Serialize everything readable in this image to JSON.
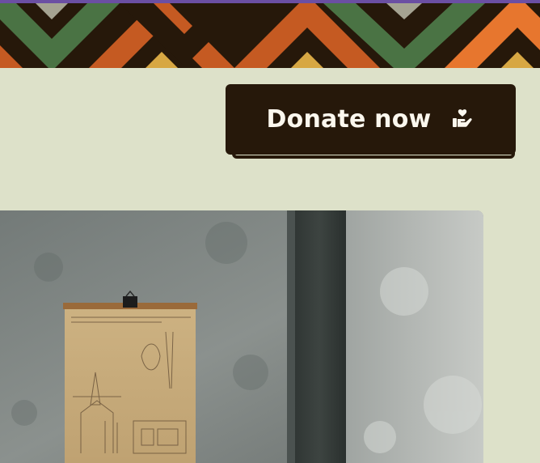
{
  "banner": {
    "colors": [
      "#4a7344",
      "#c55a22",
      "#26180a",
      "#e7762e",
      "#d7a743",
      "#a5a392"
    ]
  },
  "donate": {
    "label": "Donate now",
    "icon": "hand-holding-heart-icon"
  },
  "photo": {
    "description_icon": "photo-image"
  }
}
